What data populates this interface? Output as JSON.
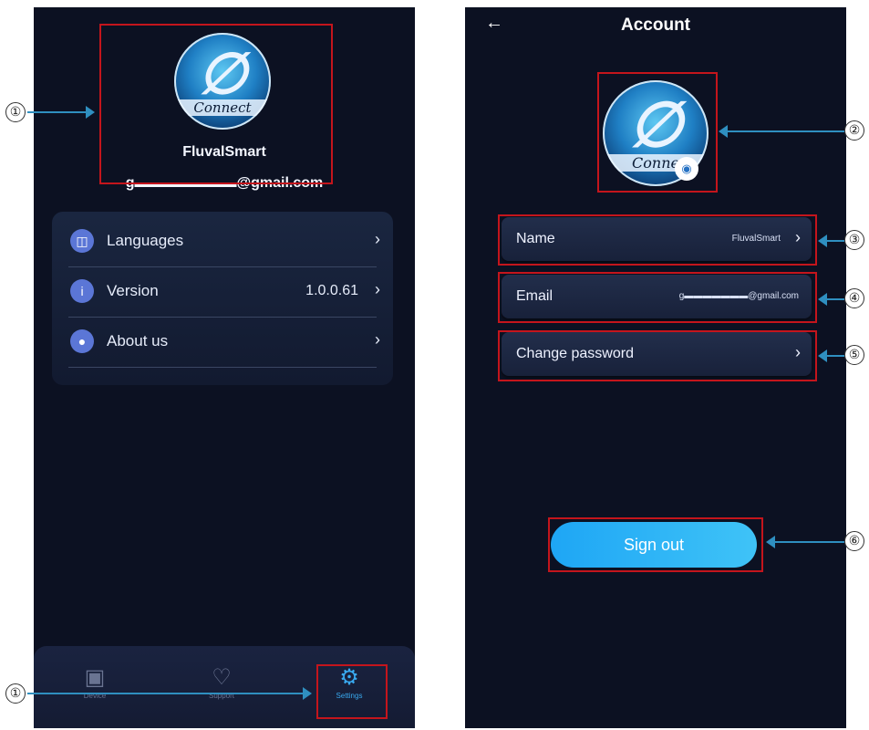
{
  "settings_screen": {
    "profile": {
      "avatar_brand": "Connect",
      "name": "FluvalSmart",
      "email": "g▬▬▬▬▬▬▬@gmail.com"
    },
    "menu": [
      {
        "label": "Languages",
        "value": "",
        "icon": "globe-icon"
      },
      {
        "label": "Version",
        "value": "1.0.0.61",
        "icon": "info-icon"
      },
      {
        "label": "About us",
        "value": "",
        "icon": "people-icon"
      }
    ],
    "tabs": [
      {
        "label": "Device",
        "icon": "device-icon",
        "active": false
      },
      {
        "label": "Support",
        "icon": "heart-icon",
        "active": false
      },
      {
        "label": "Settings",
        "icon": "gear-icon",
        "active": true
      }
    ]
  },
  "account_screen": {
    "title": "Account",
    "back_icon": "back-arrow-icon",
    "avatar_brand": "Conne",
    "rows": [
      {
        "label": "Name",
        "value": "FluvalSmart"
      },
      {
        "label": "Email",
        "value": "g▬▬▬▬▬▬▬@gmail.com"
      },
      {
        "label": "Change password",
        "value": ""
      }
    ],
    "sign_out_label": "Sign out"
  },
  "callouts": [
    "①",
    "①",
    "②",
    "③",
    "④",
    "⑤",
    "⑥"
  ],
  "colors": {
    "screen_bg": "#0c1122",
    "highlight_box": "#c4151c",
    "arrow": "#2f8fc0",
    "accent": "#39a9ef",
    "button": "#2ab4f6"
  }
}
